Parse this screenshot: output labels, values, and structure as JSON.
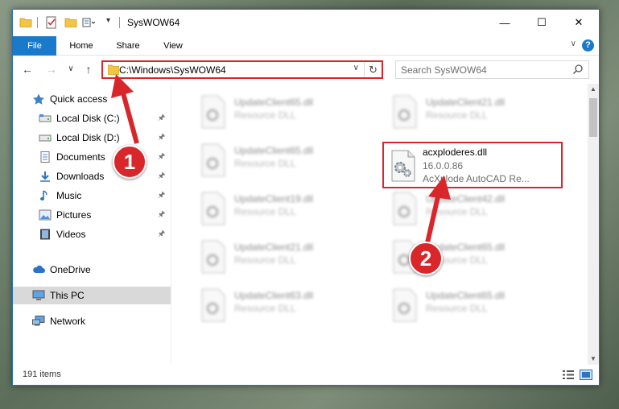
{
  "window": {
    "title": "SysWOW64",
    "minimize": "—",
    "maximize": "☐",
    "close": "✕"
  },
  "ribbon": {
    "tabs": [
      "File",
      "Home",
      "Share",
      "View"
    ],
    "help": "?",
    "collapse": "∨"
  },
  "nav": {
    "back": "←",
    "forward": "→",
    "recent": "∨",
    "up": "↑",
    "address": "C:\\Windows\\SysWOW64",
    "address_dropdown": "∨",
    "refresh": "↻",
    "search_placeholder": "Search SysWOW64"
  },
  "sidebar": {
    "pin": "📌",
    "items": [
      {
        "label": "Quick access",
        "icon": "star-icon"
      },
      {
        "label": "Local Disk (C:)",
        "icon": "drive-icon",
        "pinned": true
      },
      {
        "label": "Local Disk (D:)",
        "icon": "drive-icon",
        "pinned": true
      },
      {
        "label": "Documents",
        "icon": "documents-icon",
        "pinned": true
      },
      {
        "label": "Downloads",
        "icon": "download-icon",
        "pinned": true
      },
      {
        "label": "Music",
        "icon": "music-icon",
        "pinned": true
      },
      {
        "label": "Pictures",
        "icon": "pictures-icon",
        "pinned": true
      },
      {
        "label": "Videos",
        "icon": "videos-icon",
        "pinned": true
      },
      {
        "label": "OneDrive",
        "icon": "cloud-icon"
      },
      {
        "label": "This PC",
        "icon": "computer-icon",
        "selected": true
      },
      {
        "label": "Network",
        "icon": "network-icon"
      }
    ]
  },
  "files": [
    {
      "name": "UpdateClient65.dll",
      "type": "Resource DLL"
    },
    {
      "name": "UpdateClient21.dll",
      "type": "Resource DLL"
    },
    {
      "name": "UpdateClient65.dll",
      "type": "Resource DLL"
    },
    {
      "name": "UpdateClient19.dll",
      "type": "Resource DLL"
    },
    {
      "name": "UpdateClient42.dll",
      "type": "Resource DLL"
    },
    {
      "name": "UpdateClient21.dll",
      "type": "Resource DLL"
    },
    {
      "name": "UpdateClient65.dll",
      "type": "Resource DLL"
    },
    {
      "name": "UpdateClient63.dll",
      "type": "Resource DLL"
    },
    {
      "name": "UpdateClient65.dll",
      "type": "Resource DLL"
    }
  ],
  "highlighted_file": {
    "name": "acxploderes.dll",
    "version": "16.0.0.86",
    "description": "AcXplode AutoCAD Re..."
  },
  "status": {
    "item_count": "191 items"
  },
  "annotations": {
    "step1": "1",
    "step2": "2"
  },
  "colors": {
    "accent": "#1979ca",
    "highlight_red": "#d9262b"
  }
}
